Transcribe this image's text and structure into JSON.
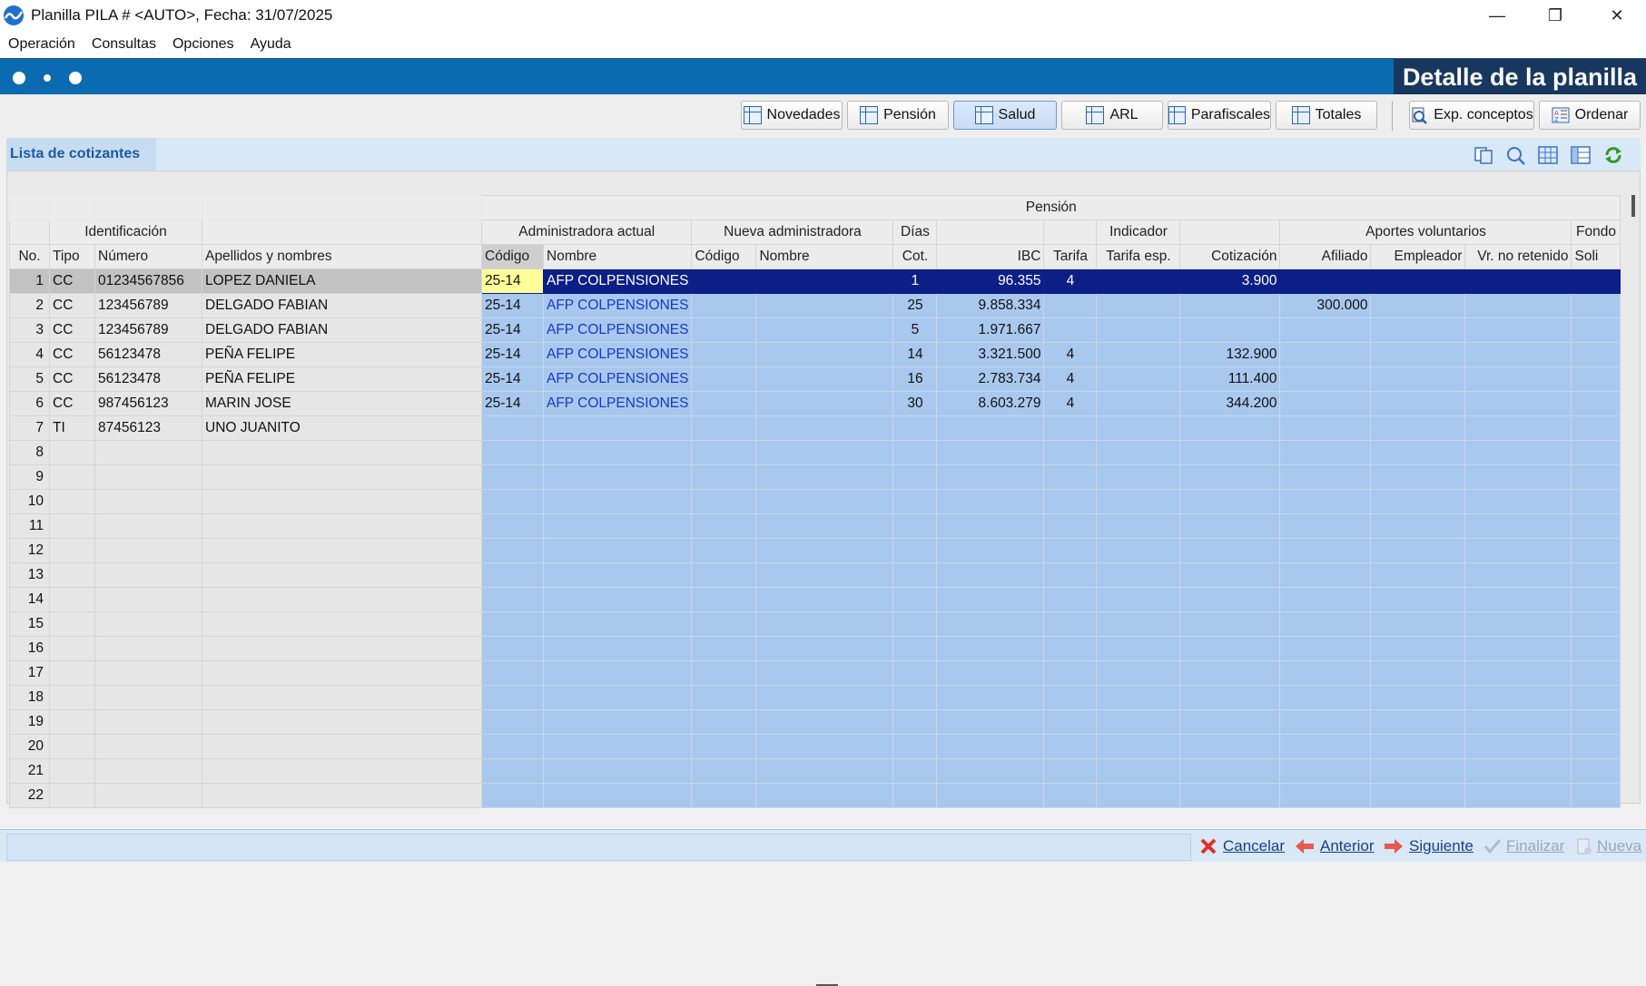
{
  "window": {
    "title": "Planilla PILA # <AUTO>, Fecha: 31/07/2025"
  },
  "menu": [
    "Operación",
    "Consultas",
    "Opciones",
    "Ayuda"
  ],
  "header": {
    "banner": "Detalle de la planilla"
  },
  "toolbar": {
    "buttons": [
      "Novedades",
      "Pensión",
      "Salud",
      "ARL",
      "Parafiscales",
      "Totales"
    ],
    "exp_label": "Exp. conceptos",
    "ordenar_label": "Ordenar"
  },
  "list_title": "Lista de cotizantes",
  "grid": {
    "group_pension": "Pensión",
    "group_identificacion": "Identificación",
    "group_admin_actual": "Administradora actual",
    "group_nueva_admin": "Nueva administradora",
    "group_dias": "Días",
    "group_indicador": "Indicador",
    "group_aportes": "Aportes voluntarios",
    "group_fondo": "Fondo",
    "columns": [
      "No.",
      "Tipo",
      "Número",
      "Apellidos y nombres",
      "Código",
      "Nombre",
      "Código",
      "Nombre",
      "Cot.",
      "IBC",
      "Tarifa",
      "Tarifa esp.",
      "Cotización",
      "Afiliado",
      "Empleador",
      "Vr. no retenido",
      "Soli"
    ],
    "rows": [
      [
        "1",
        "CC",
        "01234567856",
        "LOPEZ DANIELA",
        "25-14",
        "AFP COLPENSIONES",
        "",
        "",
        "1",
        "96.355",
        "4",
        "",
        "3.900",
        "",
        "",
        "",
        ""
      ],
      [
        "2",
        "CC",
        "123456789",
        "DELGADO FABIAN",
        "25-14",
        "AFP COLPENSIONES",
        "",
        "",
        "25",
        "9.858.334",
        "",
        "",
        "",
        "300.000",
        "",
        "",
        ""
      ],
      [
        "3",
        "CC",
        "123456789",
        "DELGADO FABIAN",
        "25-14",
        "AFP COLPENSIONES",
        "",
        "",
        "5",
        "1.971.667",
        "",
        "",
        "",
        "",
        "",
        "",
        ""
      ],
      [
        "4",
        "CC",
        "56123478",
        "PEÑA FELIPE",
        "25-14",
        "AFP COLPENSIONES",
        "",
        "",
        "14",
        "3.321.500",
        "4",
        "",
        "132.900",
        "",
        "",
        "",
        ""
      ],
      [
        "5",
        "CC",
        "56123478",
        "PEÑA FELIPE",
        "25-14",
        "AFP COLPENSIONES",
        "",
        "",
        "16",
        "2.783.734",
        "4",
        "",
        "111.400",
        "",
        "",
        "",
        ""
      ],
      [
        "6",
        "CC",
        "987456123",
        "MARIN JOSE",
        "25-14",
        "AFP COLPENSIONES",
        "",
        "",
        "30",
        "8.603.279",
        "4",
        "",
        "344.200",
        "",
        "",
        "",
        ""
      ],
      [
        "7",
        "TI",
        "87456123",
        "UNO JUANITO",
        "",
        "",
        "",
        "",
        "",
        "",
        "",
        "",
        "",
        "",
        "",
        "",
        ""
      ],
      [
        "8",
        "",
        "",
        "",
        "",
        "",
        "",
        "",
        "",
        "",
        "",
        "",
        "",
        "",
        "",
        "",
        ""
      ],
      [
        "9",
        "",
        "",
        "",
        "",
        "",
        "",
        "",
        "",
        "",
        "",
        "",
        "",
        "",
        "",
        "",
        ""
      ],
      [
        "10",
        "",
        "",
        "",
        "",
        "",
        "",
        "",
        "",
        "",
        "",
        "",
        "",
        "",
        "",
        "",
        ""
      ],
      [
        "11",
        "",
        "",
        "",
        "",
        "",
        "",
        "",
        "",
        "",
        "",
        "",
        "",
        "",
        "",
        "",
        ""
      ],
      [
        "12",
        "",
        "",
        "",
        "",
        "",
        "",
        "",
        "",
        "",
        "",
        "",
        "",
        "",
        "",
        "",
        ""
      ],
      [
        "13",
        "",
        "",
        "",
        "",
        "",
        "",
        "",
        "",
        "",
        "",
        "",
        "",
        "",
        "",
        "",
        ""
      ],
      [
        "14",
        "",
        "",
        "",
        "",
        "",
        "",
        "",
        "",
        "",
        "",
        "",
        "",
        "",
        "",
        "",
        ""
      ],
      [
        "15",
        "",
        "",
        "",
        "",
        "",
        "",
        "",
        "",
        "",
        "",
        "",
        "",
        "",
        "",
        "",
        ""
      ],
      [
        "16",
        "",
        "",
        "",
        "",
        "",
        "",
        "",
        "",
        "",
        "",
        "",
        "",
        "",
        "",
        "",
        ""
      ],
      [
        "17",
        "",
        "",
        "",
        "",
        "",
        "",
        "",
        "",
        "",
        "",
        "",
        "",
        "",
        "",
        "",
        ""
      ],
      [
        "18",
        "",
        "",
        "",
        "",
        "",
        "",
        "",
        "",
        "",
        "",
        "",
        "",
        "",
        "",
        "",
        ""
      ],
      [
        "19",
        "",
        "",
        "",
        "",
        "",
        "",
        "",
        "",
        "",
        "",
        "",
        "",
        "",
        "",
        "",
        ""
      ],
      [
        "20",
        "",
        "",
        "",
        "",
        "",
        "",
        "",
        "",
        "",
        "",
        "",
        "",
        "",
        "",
        "",
        ""
      ],
      [
        "21",
        "",
        "",
        "",
        "",
        "",
        "",
        "",
        "",
        "",
        "",
        "",
        "",
        "",
        "",
        "",
        ""
      ],
      [
        "22",
        "",
        "",
        "",
        "",
        "",
        "",
        "",
        "",
        "",
        "",
        "",
        "",
        "",
        "",
        "",
        ""
      ]
    ],
    "selected_row": 0
  },
  "footer": {
    "cancelar": "Cancelar",
    "anterior": "Anterior",
    "siguiente": "Siguiente",
    "finalizar": "Finalizar",
    "nueva": "Nueva"
  },
  "colors": {
    "header_blue": "#0a6bb0",
    "banner_navy": "#17375e",
    "cell_blue": "#a9c8ee",
    "selected_row": "#0b1f86",
    "link_blue": "#1a36c8",
    "status_bg": "#d9e8f7"
  },
  "icons": {
    "app": "app-logo-icon",
    "tab": "table-icon",
    "exp": "export-icon",
    "ordenar": "sort-icon",
    "copy": "copy-icon",
    "search": "search-icon",
    "grid": "grid-icon",
    "columns": "columns-icon",
    "refresh": "refresh-icon",
    "cancel": "cancel-icon",
    "prev": "arrow-left-icon",
    "next": "arrow-right-icon",
    "finish": "check-icon",
    "new": "new-icon"
  }
}
